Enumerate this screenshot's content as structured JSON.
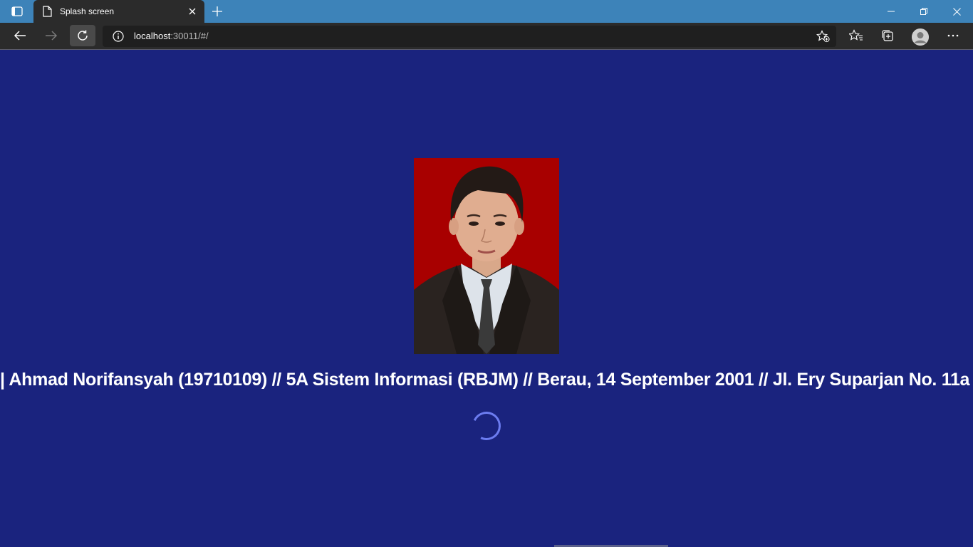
{
  "browser": {
    "tab": {
      "title": "Splash screen"
    },
    "address": {
      "host": "localhost",
      "rest": ":30011/#/"
    }
  },
  "splash": {
    "info_line": "| Ahmad Norifansyah (19710109) // 5A Sistem Informasi (RBJM) // Berau, 14 September 2001 // Jl. Ery Suparjan No. 11a |",
    "loading": true
  },
  "colors": {
    "page_background": "#1a237e",
    "titlebar": "#3d83b9",
    "toolbar": "#2b2b2b",
    "spinner": "#6c7cf0",
    "photo_background": "#a80000"
  },
  "icons": [
    "tab-actions-icon",
    "page-icon",
    "close-icon",
    "plus-icon",
    "minimize-icon",
    "restore-icon",
    "close-window-icon",
    "back-arrow-icon",
    "forward-arrow-icon",
    "refresh-icon",
    "info-icon",
    "add-favorite-icon",
    "favorites-icon",
    "collections-icon",
    "profile-icon",
    "more-icon"
  ]
}
